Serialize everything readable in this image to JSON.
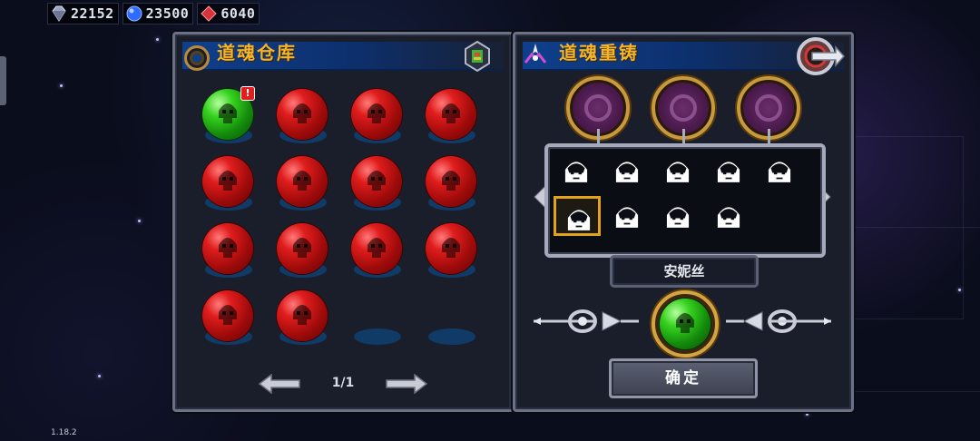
{
  "resources": [
    {
      "icon": "diamond-icon",
      "value": "22152",
      "color": "#9aa3c4"
    },
    {
      "icon": "blue-gem-icon",
      "value": "23500",
      "color": "#2e6bff"
    },
    {
      "icon": "red-gem-icon",
      "value": "6040",
      "color": "#d8323a"
    }
  ],
  "warehouse": {
    "title": "道魂仓库",
    "alert_badge": "!",
    "orbs": [
      {
        "color": "green",
        "alert": true
      },
      {
        "color": "red"
      },
      {
        "color": "red"
      },
      {
        "color": "red"
      },
      {
        "color": "red"
      },
      {
        "color": "red"
      },
      {
        "color": "red"
      },
      {
        "color": "red"
      },
      {
        "color": "red"
      },
      {
        "color": "red"
      },
      {
        "color": "red"
      },
      {
        "color": "red"
      },
      {
        "color": "red"
      },
      {
        "color": "red"
      },
      {
        "color": "empty"
      },
      {
        "color": "empty"
      }
    ],
    "page_indicator": "1/1"
  },
  "reforge": {
    "title": "道魂重铸",
    "selected_name": "安妮丝",
    "confirm_label": "确定"
  },
  "version": "1.18.2",
  "colors": {
    "accent_gold": "#f1b42a",
    "title_blue": "#0f3f8c",
    "panel_bg": "#1a1e2b"
  }
}
